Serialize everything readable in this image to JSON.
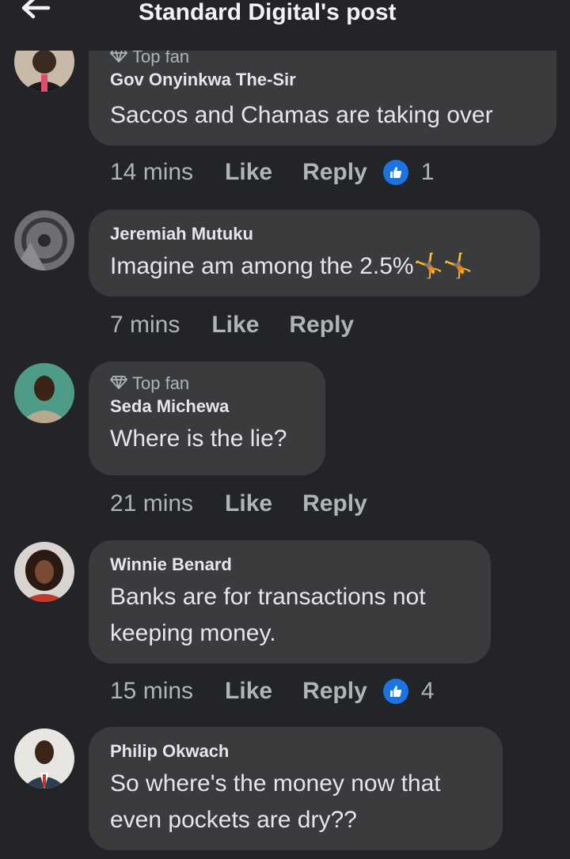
{
  "header": {
    "title": "Standard Digital's post"
  },
  "icons": {
    "back": "arrow-left-icon",
    "top_fan": "diamond-icon",
    "reaction": "thumbs-up-like-icon",
    "emoji": "person-cartwheeling-emoji"
  },
  "colors": {
    "background": "#232427",
    "bubble": "#3a3b3c",
    "muted_text": "#b0b3b8",
    "like_blue": "#1b74e4"
  },
  "comments": [
    {
      "badge": "Top fan",
      "name": "Gov Onyinkwa The-Sir",
      "text": [
        "Saccos and Chamas are taking over"
      ],
      "time": "14 mins",
      "like": "Like",
      "reply": "Reply",
      "reactions": "1"
    },
    {
      "name": "Jeremiah Mutuku",
      "text": [
        "Imagine am among the 2.5%"
      ],
      "emoji": "🤸🤸",
      "time": "7 mins",
      "like": "Like",
      "reply": "Reply"
    },
    {
      "badge": "Top fan",
      "name": "Seda Michewa",
      "text": [
        "Where is the lie?"
      ],
      "time": "21 mins",
      "like": "Like",
      "reply": "Reply"
    },
    {
      "name": "Winnie Benard",
      "text": [
        "Banks are for transactions not",
        "keeping money."
      ],
      "time": "15 mins",
      "like": "Like",
      "reply": "Reply",
      "reactions": "4"
    },
    {
      "name": "Philip Okwach",
      "text": [
        "So where's the money now that",
        "even pockets are dry??"
      ]
    }
  ]
}
